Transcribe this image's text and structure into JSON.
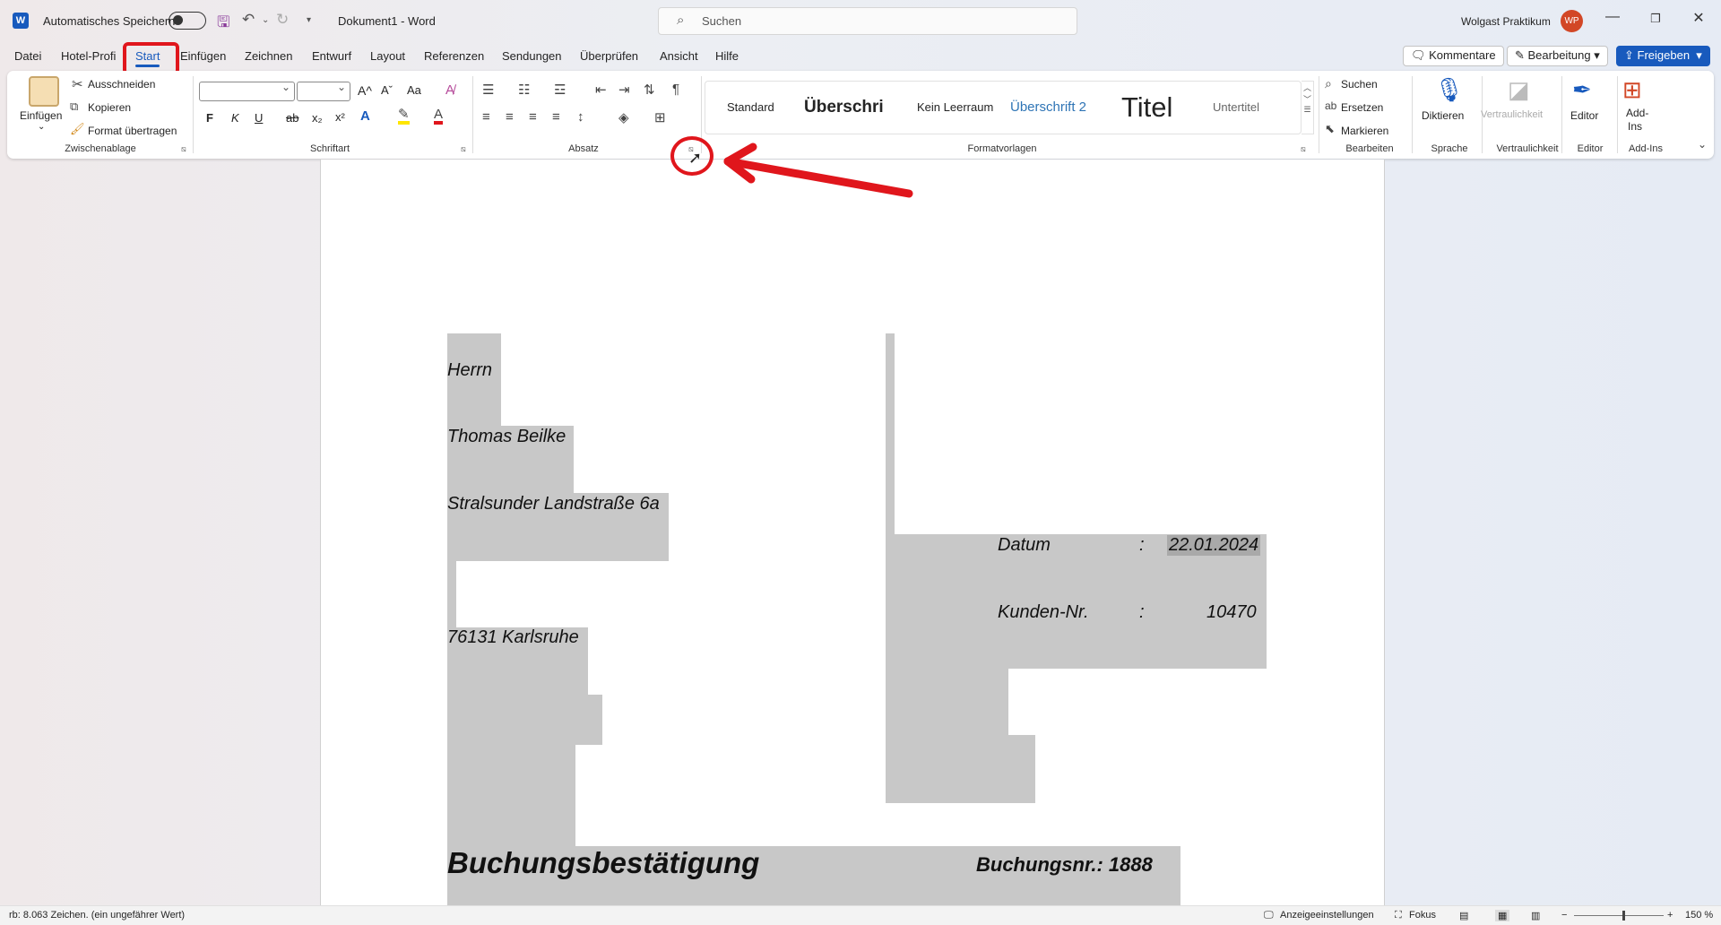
{
  "titlebar": {
    "app_icon": "W",
    "autosave_label": "Automatisches Speichern",
    "doc_title": "Dokument1  -  Word",
    "search_placeholder": "Suchen",
    "user_name": "Wolgast Praktikum",
    "user_initials": "WP"
  },
  "tabs": [
    "Datei",
    "Hotel-Profi",
    "Start",
    "Einfügen",
    "Zeichnen",
    "Entwurf",
    "Layout",
    "Referenzen",
    "Sendungen",
    "Überprüfen",
    "Ansicht",
    "Hilfe"
  ],
  "active_tab": "Start",
  "right_buttons": {
    "comments": "Kommentare",
    "editing": "Bearbeitung",
    "share": "Freigeben"
  },
  "ribbon": {
    "clipboard": {
      "paste": "Einfügen",
      "cut": "Ausschneiden",
      "copy": "Kopieren",
      "format_painter": "Format übertragen",
      "label": "Zwischenablage"
    },
    "font": {
      "bold": "F",
      "italic": "K",
      "underline": "U",
      "strike": "ab",
      "sub": "x₂",
      "sup": "x²",
      "grow": "A^",
      "shrink": "Aˇ",
      "case": "Aa",
      "label": "Schriftart"
    },
    "paragraph": {
      "label": "Absatz"
    },
    "styles": {
      "items": [
        "Standard",
        "Überschri",
        "Kein Leerraum",
        "Überschrift 2",
        "Titel",
        "Untertitel"
      ],
      "label": "Formatvorlagen"
    },
    "editing": {
      "find": "Suchen",
      "replace": "Ersetzen",
      "select": "Markieren",
      "label": "Bearbeiten"
    },
    "voice": {
      "dictate": "Diktieren",
      "label": "Sprache"
    },
    "sensitivity": {
      "button": "Vertraulichkeit",
      "label": "Vertraulichkeit"
    },
    "editor": {
      "button": "Editor",
      "label": "Editor"
    },
    "addins": {
      "button_line1": "Add-",
      "button_line2": "Ins",
      "label": "Add-Ins"
    }
  },
  "document": {
    "salutation": "Herrn",
    "name": "Thomas Beilke",
    "street": "Stralsunder Landstraße 6a",
    "city": "76131 Karlsruhe",
    "date_label": "Datum",
    "colon": ":",
    "date_value": "22.01.2024",
    "customer_label": "Kunden-Nr.",
    "customer_value": "10470",
    "heading": "Buchungsbestätigung",
    "booking_no": "Buchungsnr.: 1888"
  },
  "statusbar": {
    "left": "rb: 8.063 Zeichen. (ein ungefährer Wert)",
    "display_settings": "Anzeigeeinstellungen",
    "focus": "Fokus",
    "zoom": "150 %"
  },
  "colors": {
    "accent": "#185abd",
    "annotation": "#e0161c",
    "shading": "#c8c8c8"
  }
}
